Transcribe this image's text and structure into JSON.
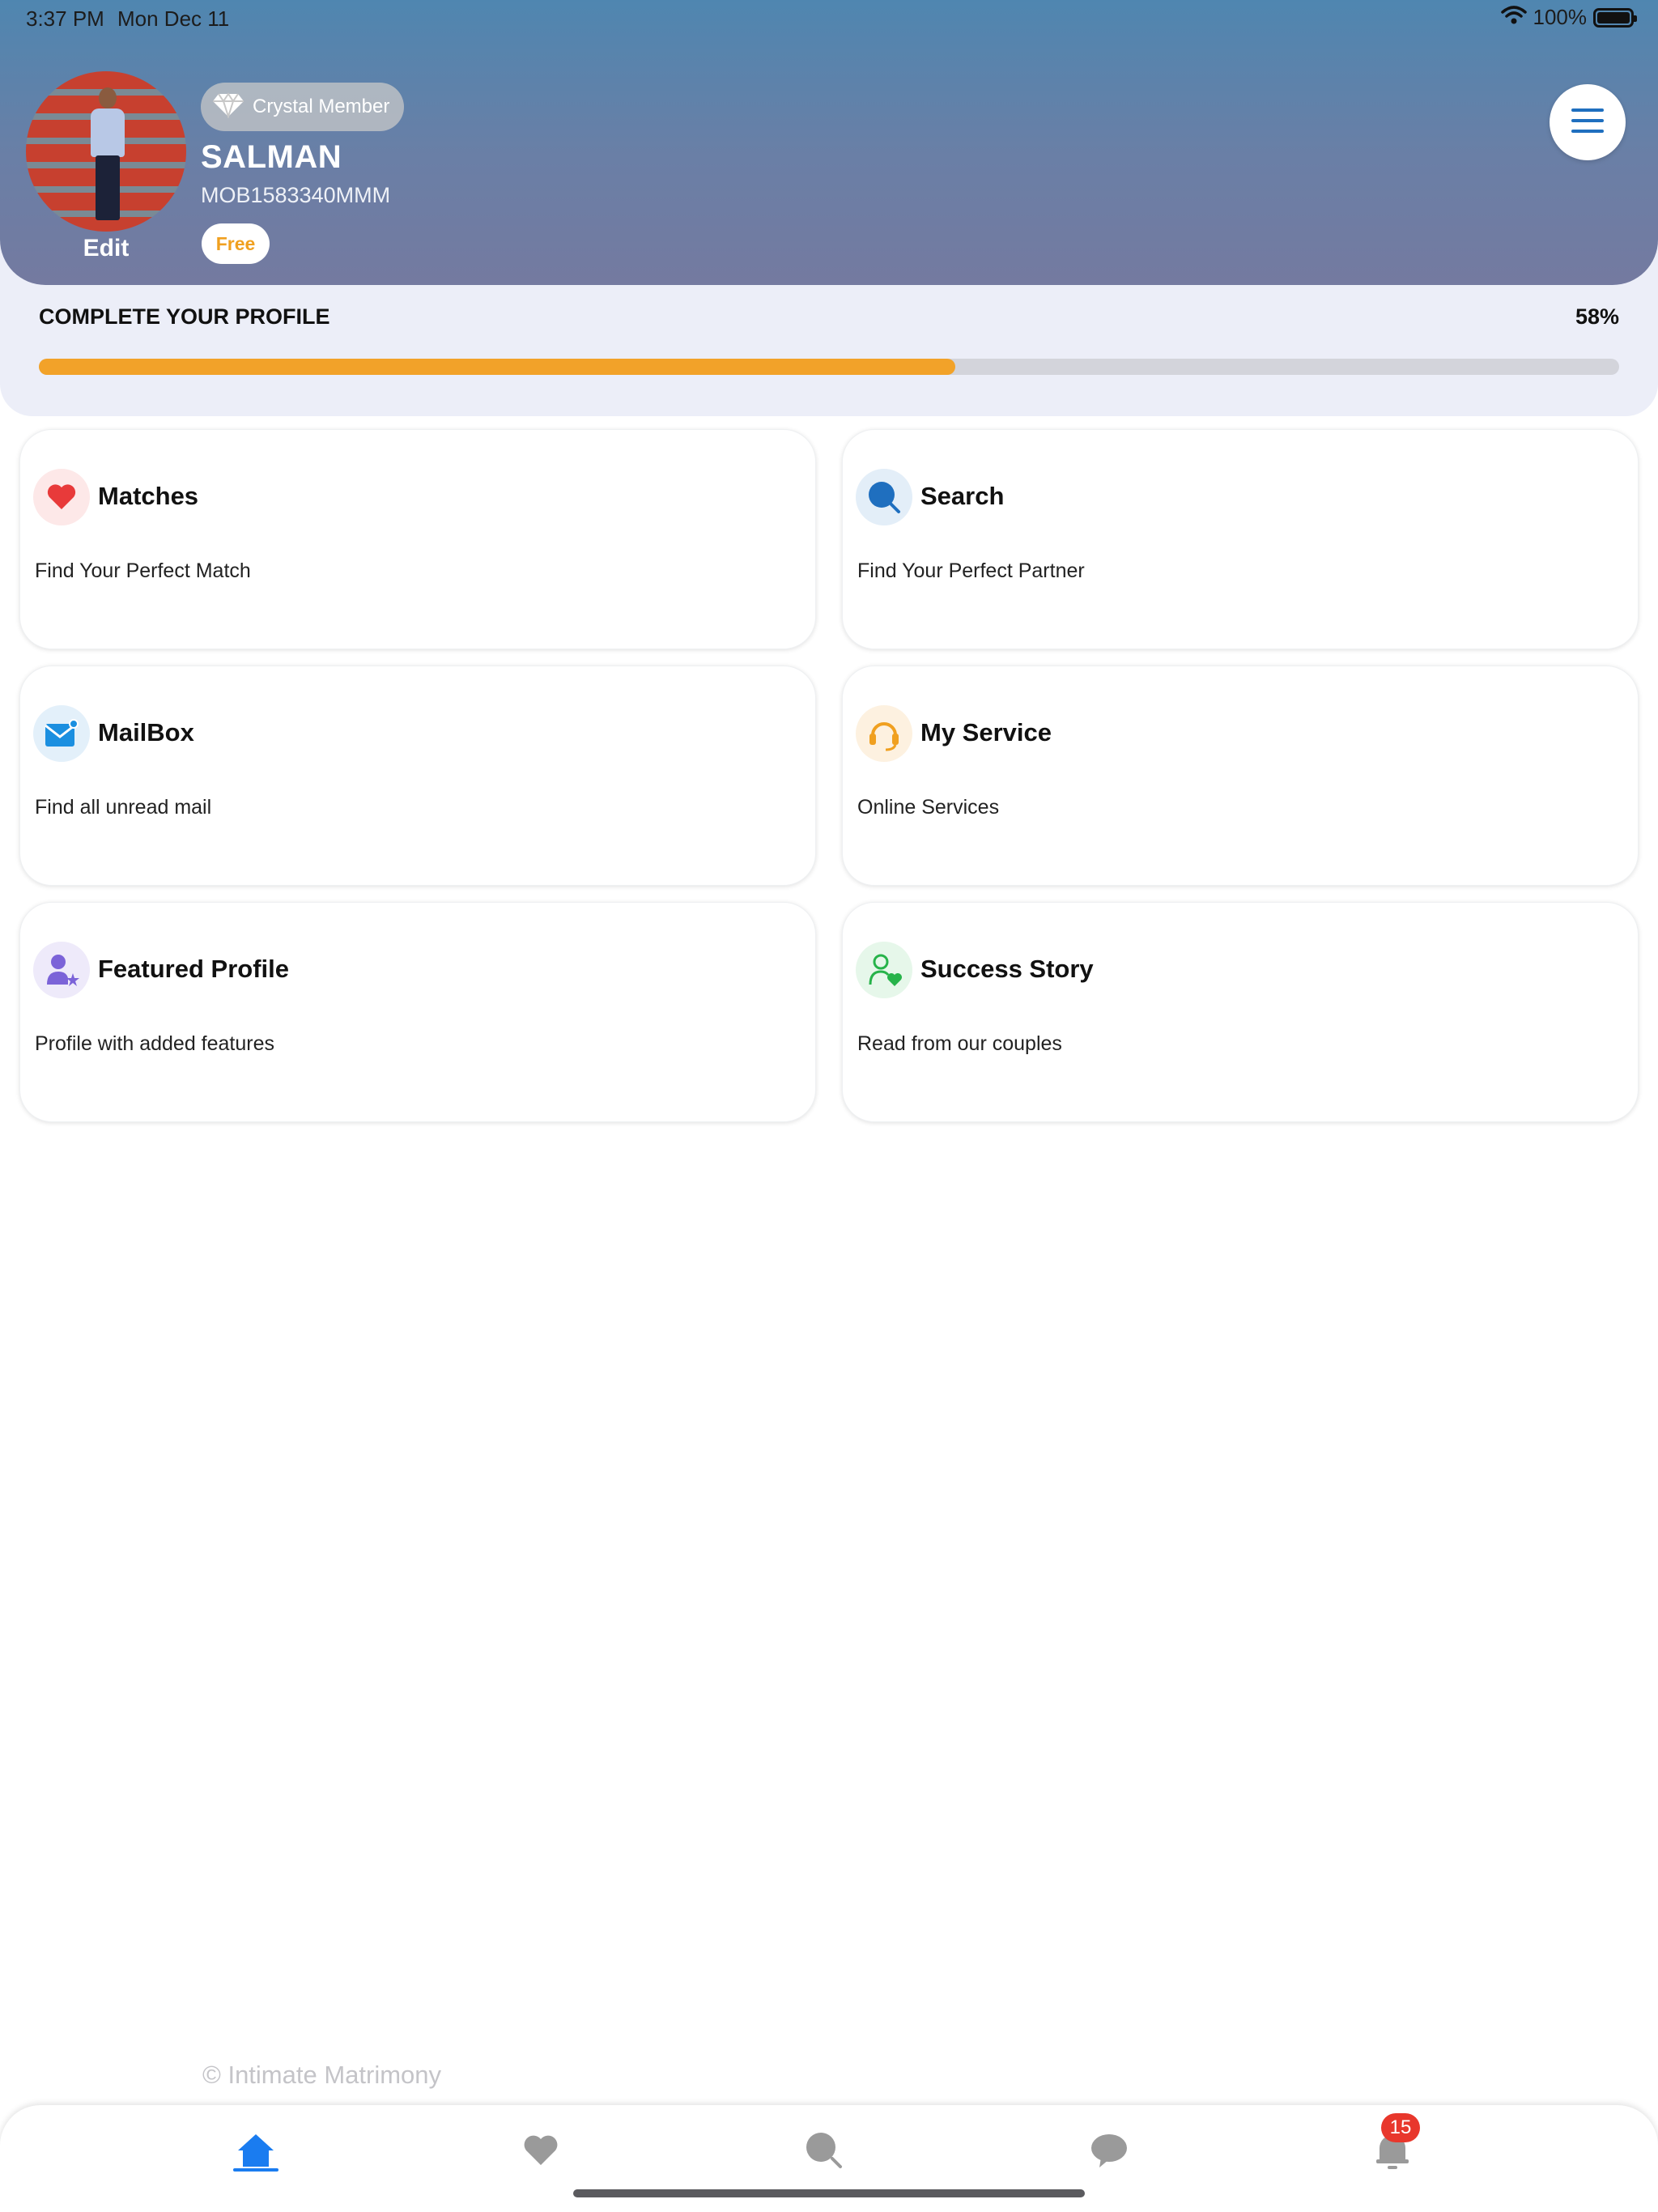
{
  "status": {
    "time": "3:37 PM",
    "date": "Mon Dec 11",
    "battery": "100%"
  },
  "profile": {
    "badge": "Crystal Member",
    "name": "SALMAN",
    "member_id": "MOB1583340MMM",
    "plan": "Free",
    "edit_label": "Edit"
  },
  "completion": {
    "title": "COMPLETE YOUR PROFILE",
    "percent_label": "58%",
    "percent": 58
  },
  "cards": [
    {
      "title": "Matches",
      "subtitle": "Find Your Perfect Match",
      "icon": "heart-icon",
      "color": "#e83a3a"
    },
    {
      "title": "Search",
      "subtitle": "Find Your Perfect Partner",
      "icon": "search-icon",
      "color": "#1f6fbf"
    },
    {
      "title": "MailBox",
      "subtitle": "Find all unread mail",
      "icon": "mail-icon",
      "color": "#1b8fe0"
    },
    {
      "title": "My Service",
      "subtitle": "Online Services",
      "icon": "headset-icon",
      "color": "#f0a020"
    },
    {
      "title": "Featured Profile",
      "subtitle": "Profile with added features",
      "icon": "user-star-icon",
      "color": "#7b63d8"
    },
    {
      "title": "Success Story",
      "subtitle": "Read from our couples",
      "icon": "user-heart-icon",
      "color": "#27b34a"
    }
  ],
  "footer": {
    "copyright": "© Intimate Matrimony"
  },
  "tabbar": {
    "items": [
      "home-icon",
      "heart-icon",
      "search-icon",
      "chat-icon",
      "bell-icon"
    ],
    "active": "home-icon",
    "notification_count": "15",
    "active_color": "#1a7cf0",
    "inactive_color": "#9a9a9a"
  }
}
